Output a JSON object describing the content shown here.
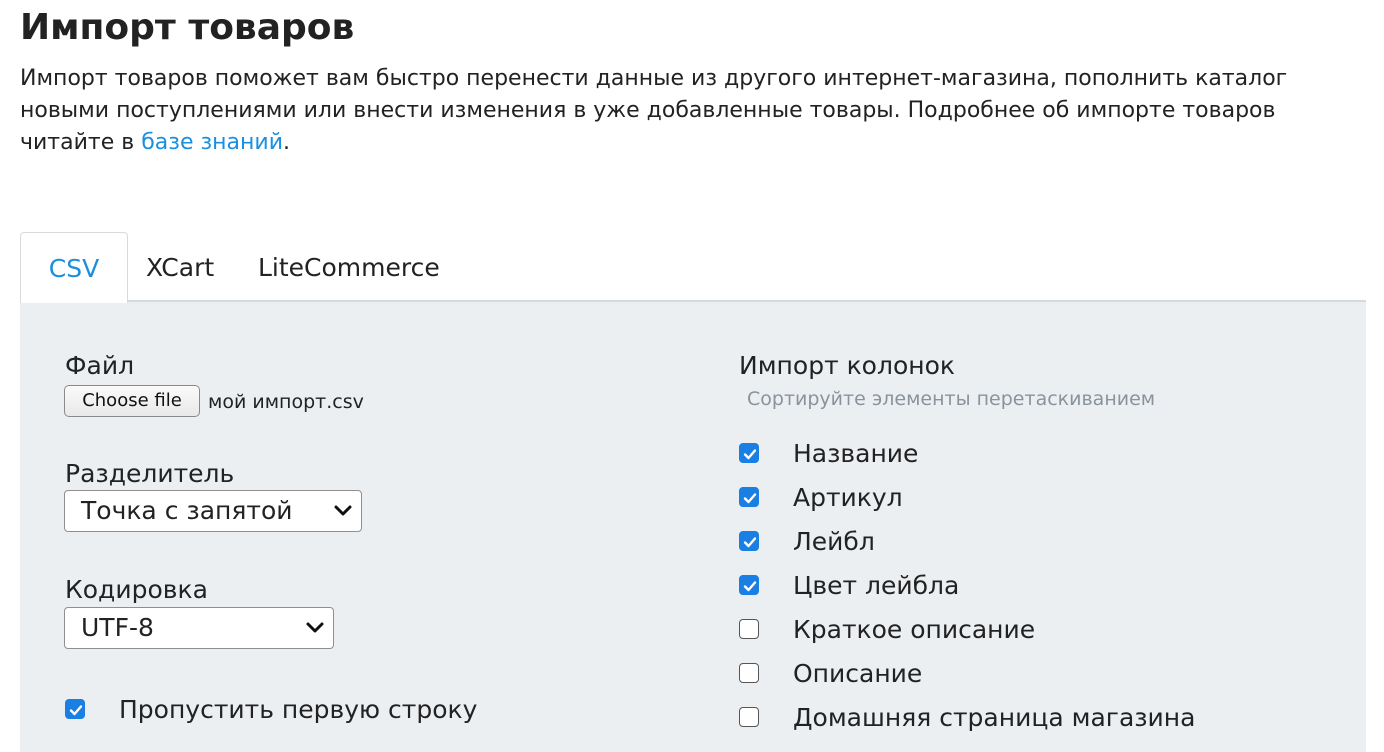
{
  "page": {
    "title": "Импорт товаров",
    "intro_text": "Импорт товаров поможет вам быстро перенести данные из другого интернет-магазина, пополнить каталог новыми поступлениями или внести изменения в уже добавленные товары. Подробнее об импорте товаров читайте в ",
    "intro_link": "базе знаний",
    "intro_end": "."
  },
  "tabs": [
    {
      "label": "CSV",
      "active": true
    },
    {
      "label": "XCart",
      "active": false
    },
    {
      "label": "LiteCommerce",
      "active": false
    }
  ],
  "form": {
    "file_label": "Файл",
    "file_button": "Choose file",
    "file_name": "мой импорт.csv",
    "delimiter_label": "Разделитель",
    "delimiter_value": "Точка с запятой",
    "encoding_label": "Кодировка",
    "encoding_value": "UTF-8",
    "skip_first_row_label": "Пропустить первую строку",
    "skip_first_row_checked": true
  },
  "columns": {
    "title": "Импорт колонок",
    "hint": "Сортируйте элементы перетаскиванием",
    "items": [
      {
        "label": "Название",
        "checked": true
      },
      {
        "label": "Артикул",
        "checked": true
      },
      {
        "label": "Лейбл",
        "checked": true
      },
      {
        "label": "Цвет лейбла",
        "checked": true
      },
      {
        "label": "Краткое описание",
        "checked": false
      },
      {
        "label": "Описание",
        "checked": false
      },
      {
        "label": "Домашняя страница магазина",
        "checked": false
      }
    ]
  },
  "colors": {
    "accent": "#1a8fe0",
    "checkbox_on": "#1a7fe3",
    "panel_bg": "#eceff2",
    "hint": "#8a939b"
  }
}
